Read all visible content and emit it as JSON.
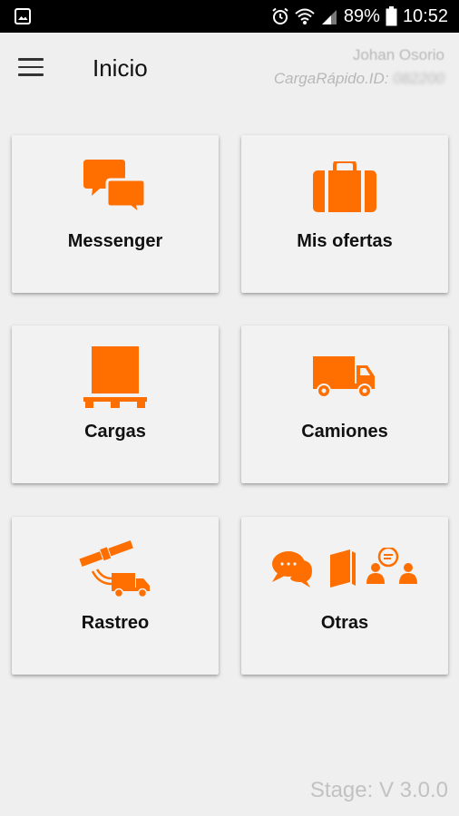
{
  "status_bar": {
    "battery": "89%",
    "time": "10:52",
    "icons": [
      "gallery-icon",
      "alarm-icon",
      "wifi-icon",
      "signal-icon",
      "battery-icon"
    ]
  },
  "header": {
    "menu_icon": "hamburger-menu-icon",
    "title": "Inicio",
    "user_name": "Johan Osorio",
    "user_id_label": "CargaRápido.ID:",
    "user_id_value": "082200"
  },
  "accent_color": "#ff6f00",
  "cards": [
    {
      "label": "Messenger",
      "icon": "chat-bubbles-icon"
    },
    {
      "label": "Mis ofertas",
      "icon": "briefcase-icon"
    },
    {
      "label": "Cargas",
      "icon": "cargo-box-icon"
    },
    {
      "label": "Camiones",
      "icon": "truck-icon"
    },
    {
      "label": "Rastreo",
      "icon": "satellite-truck-icon"
    },
    {
      "label": "Otras",
      "icon": "more-options-icon"
    }
  ],
  "version": "Stage: V 3.0.0"
}
